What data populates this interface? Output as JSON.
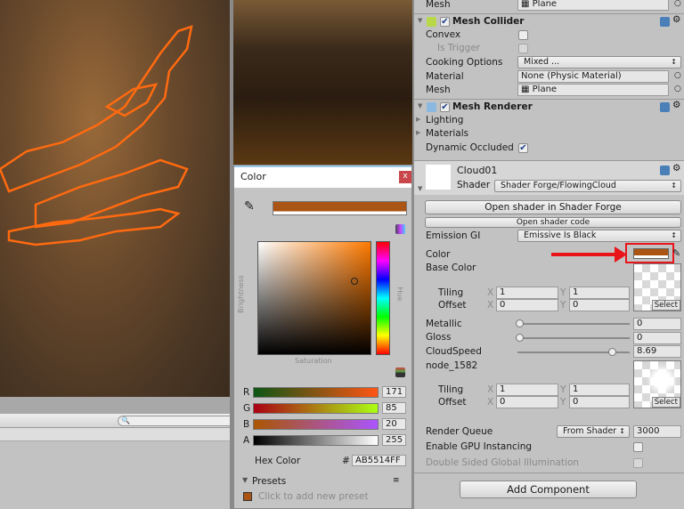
{
  "inspector": {
    "mesh_filter": {
      "label": "Mesh",
      "value": "Plane"
    },
    "mesh_collider": {
      "title": "Mesh Collider",
      "convex": "Convex",
      "is_trigger": "Is Trigger",
      "cooking_label": "Cooking Options",
      "cooking_value": "Mixed ...",
      "material_label": "Material",
      "material_value": "None (Physic Material)",
      "mesh_label": "Mesh",
      "mesh_value": "Plane"
    },
    "mesh_renderer": {
      "title": "Mesh Renderer",
      "lighting": "Lighting",
      "materials": "Materials",
      "dynamic_occluded": "Dynamic Occluded"
    },
    "material": {
      "name": "Cloud01",
      "shader_label": "Shader",
      "shader_value": "Shader Forge/FlowingCloud",
      "open_sf": "Open shader in Shader Forge",
      "open_code": "Open shader code",
      "emission_label": "Emission GI",
      "emission_value": "Emissive Is Black",
      "color_label": "Color",
      "color_value": "#AB5514",
      "base_color": "Base Color",
      "tiling": "Tiling",
      "offset": "Offset",
      "x": "X",
      "y": "Y",
      "base_tiling": [
        "1",
        "1"
      ],
      "base_offset": [
        "0",
        "0"
      ],
      "select": "Select",
      "metallic_label": "Metallic",
      "metallic_value": "0",
      "metallic_frac": 0,
      "gloss_label": "Gloss",
      "gloss_value": "0",
      "gloss_frac": 0,
      "cloudspeed_label": "CloudSpeed",
      "cloudspeed_value": "8.69",
      "cloudspeed_frac": 0.869,
      "node_label": "node_1582",
      "node_tiling": [
        "1",
        "1"
      ],
      "node_offset": [
        "0",
        "0"
      ],
      "render_queue_label": "Render Queue",
      "render_queue_mode": "From Shader",
      "render_queue_value": "3000",
      "gpu_label": "Enable GPU Instancing",
      "double_sided_label": "Double Sided Global Illumination"
    },
    "add_component": "Add Component"
  },
  "color_window": {
    "title": "Color",
    "close": "x",
    "brightness": "Brightness",
    "hue": "Hue",
    "saturation": "Saturation",
    "channels": [
      {
        "label": "R",
        "value": "171"
      },
      {
        "label": "G",
        "value": "85"
      },
      {
        "label": "B",
        "value": "20"
      },
      {
        "label": "A",
        "value": "255"
      }
    ],
    "hex_label": "Hex Color",
    "hash": "#",
    "hex_value": "AB5514FF",
    "presets": "Presets",
    "add_preset": "Click to add new preset"
  },
  "colors": {
    "accent": "#AB5514",
    "annotation": "#E8141A"
  }
}
